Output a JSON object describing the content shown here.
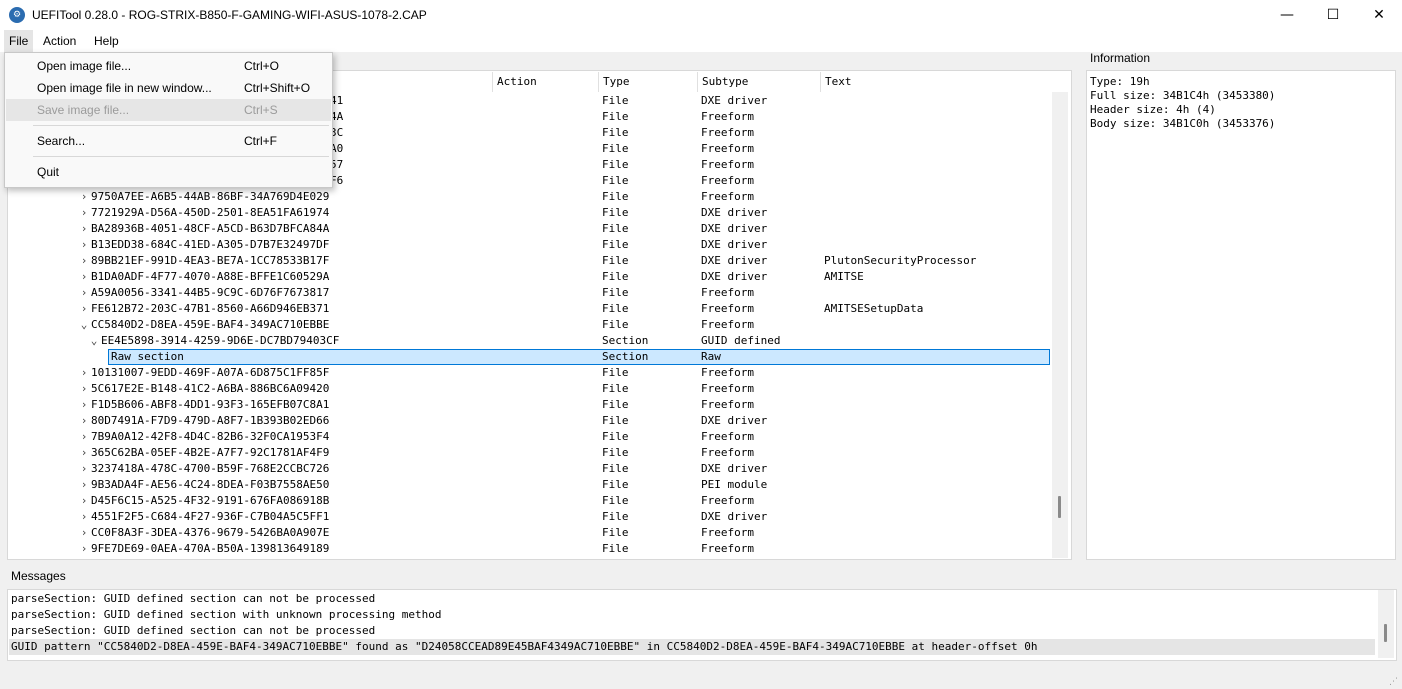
{
  "window": {
    "title": "UEFITool 0.28.0 - ROG-STRIX-B850-F-GAMING-WIFI-ASUS-1078-2.CAP",
    "app_icon_glyph": "⚙",
    "minimize_glyph": "—",
    "maximize_glyph": "☐",
    "close_glyph": "✕"
  },
  "menubar": {
    "file": "File",
    "action": "Action",
    "help": "Help"
  },
  "file_menu": {
    "items": [
      {
        "label": "Open image file...",
        "shortcut": "Ctrl+O"
      },
      {
        "label": "Open image file in new window...",
        "shortcut": "Ctrl+Shift+O"
      },
      {
        "label": "Save image file...",
        "shortcut": "Ctrl+S"
      },
      {
        "label": "Search...",
        "shortcut": "Ctrl+F"
      },
      {
        "label": "Quit",
        "shortcut": ""
      }
    ]
  },
  "tree": {
    "columns": {
      "action": "Action",
      "type": "Type",
      "subtype": "Subtype",
      "text": "Text"
    },
    "partial_rows": [
      {
        "name_tail": "41",
        "type": "File",
        "subtype": "DXE driver",
        "text": ""
      },
      {
        "name_tail": "4A",
        "type": "File",
        "subtype": "Freeform",
        "text": ""
      },
      {
        "name_tail": "3C",
        "type": "File",
        "subtype": "Freeform",
        "text": ""
      },
      {
        "name_tail": "A0",
        "type": "File",
        "subtype": "Freeform",
        "text": ""
      },
      {
        "name_tail": "57",
        "type": "File",
        "subtype": "Freeform",
        "text": ""
      },
      {
        "name_tail": "F6",
        "type": "File",
        "subtype": "Freeform",
        "text": ""
      }
    ],
    "rows": [
      {
        "chev": "›",
        "indent": 0,
        "name": "9750A7EE-A6B5-44AB-86BF-34A769D4E029",
        "type": "File",
        "subtype": "Freeform",
        "text": ""
      },
      {
        "chev": "›",
        "indent": 0,
        "name": "7721929A-D56A-450D-2501-8EA51FA61974",
        "type": "File",
        "subtype": "DXE driver",
        "text": ""
      },
      {
        "chev": "›",
        "indent": 0,
        "name": "BA28936B-4051-48CF-A5CD-B63D7BFCA84A",
        "type": "File",
        "subtype": "DXE driver",
        "text": ""
      },
      {
        "chev": "›",
        "indent": 0,
        "name": "B13EDD38-684C-41ED-A305-D7B7E32497DF",
        "type": "File",
        "subtype": "DXE driver",
        "text": ""
      },
      {
        "chev": "›",
        "indent": 0,
        "name": "89BB21EF-991D-4EA3-BE7A-1CC78533B17F",
        "type": "File",
        "subtype": "DXE driver",
        "text": "PlutonSecurityProcessor"
      },
      {
        "chev": "›",
        "indent": 0,
        "name": "B1DA0ADF-4F77-4070-A88E-BFFE1C60529A",
        "type": "File",
        "subtype": "DXE driver",
        "text": "AMITSE"
      },
      {
        "chev": "›",
        "indent": 0,
        "name": "A59A0056-3341-44B5-9C9C-6D76F7673817",
        "type": "File",
        "subtype": "Freeform",
        "text": ""
      },
      {
        "chev": "›",
        "indent": 0,
        "name": "FE612B72-203C-47B1-8560-A66D946EB371",
        "type": "File",
        "subtype": "Freeform",
        "text": "AMITSESetupData"
      },
      {
        "chev": "⌄",
        "indent": 0,
        "name": "CC5840D2-D8EA-459E-BAF4-349AC710EBBE",
        "type": "File",
        "subtype": "Freeform",
        "text": ""
      },
      {
        "chev": "⌄",
        "indent": 1,
        "name": "EE4E5898-3914-4259-9D6E-DC7BD79403CF",
        "type": "Section",
        "subtype": "GUID defined",
        "text": ""
      },
      {
        "chev": "",
        "indent": 2,
        "name": "Raw section",
        "type": "Section",
        "subtype": "Raw",
        "text": "",
        "selected": true
      },
      {
        "chev": "›",
        "indent": 0,
        "name": "10131007-9EDD-469F-A07A-6D875C1FF85F",
        "type": "File",
        "subtype": "Freeform",
        "text": ""
      },
      {
        "chev": "›",
        "indent": 0,
        "name": "5C617E2E-B148-41C2-A6BA-886BC6A09420",
        "type": "File",
        "subtype": "Freeform",
        "text": ""
      },
      {
        "chev": "›",
        "indent": 0,
        "name": "F1D5B606-ABF8-4DD1-93F3-165EFB07C8A1",
        "type": "File",
        "subtype": "Freeform",
        "text": ""
      },
      {
        "chev": "›",
        "indent": 0,
        "name": "80D7491A-F7D9-479D-A8F7-1B393B02ED66",
        "type": "File",
        "subtype": "DXE driver",
        "text": ""
      },
      {
        "chev": "›",
        "indent": 0,
        "name": "7B9A0A12-42F8-4D4C-82B6-32F0CA1953F4",
        "type": "File",
        "subtype": "Freeform",
        "text": ""
      },
      {
        "chev": "›",
        "indent": 0,
        "name": "365C62BA-05EF-4B2E-A7F7-92C1781AF4F9",
        "type": "File",
        "subtype": "Freeform",
        "text": ""
      },
      {
        "chev": "›",
        "indent": 0,
        "name": "3237418A-478C-4700-B59F-768E2CCBC726",
        "type": "File",
        "subtype": "DXE driver",
        "text": ""
      },
      {
        "chev": "›",
        "indent": 0,
        "name": "9B3ADA4F-AE56-4C24-8DEA-F03B7558AE50",
        "type": "File",
        "subtype": "PEI module",
        "text": ""
      },
      {
        "chev": "›",
        "indent": 0,
        "name": "D45F6C15-A525-4F32-9191-676FA086918B",
        "type": "File",
        "subtype": "Freeform",
        "text": ""
      },
      {
        "chev": "›",
        "indent": 0,
        "name": "4551F2F5-C684-4F27-936F-C7B04A5C5FF1",
        "type": "File",
        "subtype": "DXE driver",
        "text": ""
      },
      {
        "chev": "›",
        "indent": 0,
        "name": "CC0F8A3F-3DEA-4376-9679-5426BA0A907E",
        "type": "File",
        "subtype": "Freeform",
        "text": ""
      },
      {
        "chev": "›",
        "indent": 0,
        "name": "9FE7DE69-0AEA-470A-B50A-139813649189",
        "type": "File",
        "subtype": "Freeform",
        "text": ""
      }
    ]
  },
  "information": {
    "label": "Information",
    "lines": [
      "Type: 19h",
      "Full size: 34B1C4h (3453380)",
      "Header size: 4h (4)",
      "Body size: 34B1C0h (3453376)"
    ]
  },
  "messages": {
    "label": "Messages",
    "lines": [
      "parseSection: GUID defined section can not be processed",
      "parseSection: GUID defined section with unknown processing method",
      "parseSection: GUID defined section can not be processed",
      "GUID pattern \"CC5840D2-D8EA-459E-BAF4-349AC710EBBE\" found as \"D24058CCEAD89E45BAF4349AC710EBBE\" in CC5840D2-D8EA-459E-BAF4-349AC710EBBE at header-offset 0h"
    ]
  },
  "colors": {
    "selection_fill": "#cce8ff",
    "selection_border": "#0078d7"
  }
}
